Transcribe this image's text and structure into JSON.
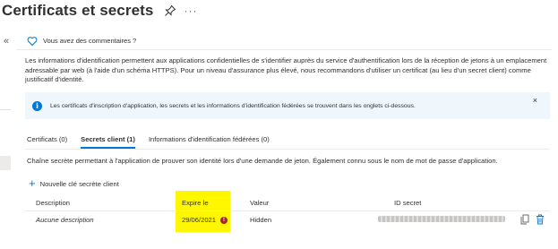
{
  "header": {
    "title": "Certificats et secrets",
    "more_label": "···"
  },
  "nav": {
    "collapse_label": "«"
  },
  "feedback": {
    "label": "Vous avez des commentaires ?"
  },
  "description": "Les informations d'identification permettent aux applications confidentielles de s'identifier auprès du service d'authentification lors de la réception de jetons à un emplacement adressable par web (à l'aide d'un schéma HTTPS). Pour un niveau d'assurance plus élevé, nous recommandons d'utiliser un certificat (au lieu d'un secret client) comme justificatif d'identité.",
  "info_banner": {
    "text": "Les certificats d'inscription d'application, les secrets et les informations d'identification fédérées se trouvent dans les onglets ci-dessous.",
    "close_label": "×"
  },
  "tabs": [
    {
      "label": "Certificats (0)",
      "active": false
    },
    {
      "label": "Secrets client (1)",
      "active": true
    },
    {
      "label": "Informations d'identification fédérées (0)",
      "active": false
    }
  ],
  "tab_description": "Chaîne secrète permettant à l'application de prouver son identité lors d'une demande de jeton. Également connu sous le nom de mot de passe d'application.",
  "add_button": {
    "icon": "+",
    "label": "Nouvelle clé secrète client"
  },
  "table": {
    "columns": [
      "Description",
      "Expire le",
      "Valeur",
      "ID secret"
    ],
    "rows": [
      {
        "description": "Aucune description",
        "expires": "29/06/2021",
        "value": "Hidden",
        "warning_icon": "!"
      }
    ]
  },
  "colors": {
    "accent": "#0078d4",
    "highlight": "#fff700",
    "warning": "#a4262c",
    "info_bg": "#eff6fc"
  }
}
